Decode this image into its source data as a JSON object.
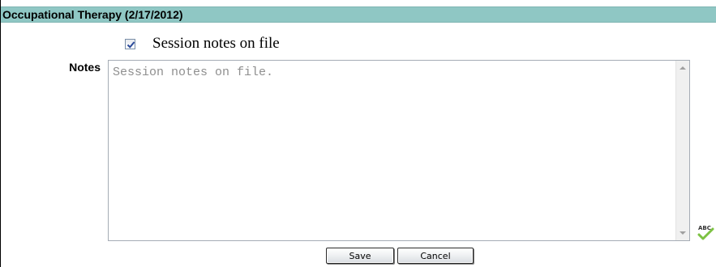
{
  "header": {
    "title": "Occupational Therapy (2/17/2012)"
  },
  "session_notes_checkbox": {
    "checked": true,
    "label": "Session notes on file"
  },
  "notes": {
    "label": "Notes",
    "value": "",
    "placeholder": "Session notes on file."
  },
  "spellcheck": {
    "icon": "spellcheck-icon",
    "text": "ABC"
  },
  "actions": {
    "save_label": "Save",
    "cancel_label": "Cancel"
  },
  "colors": {
    "header_bg": "#8fc7c4",
    "check_mark": "#2a4a9a",
    "spell_check": "#7cc242"
  }
}
